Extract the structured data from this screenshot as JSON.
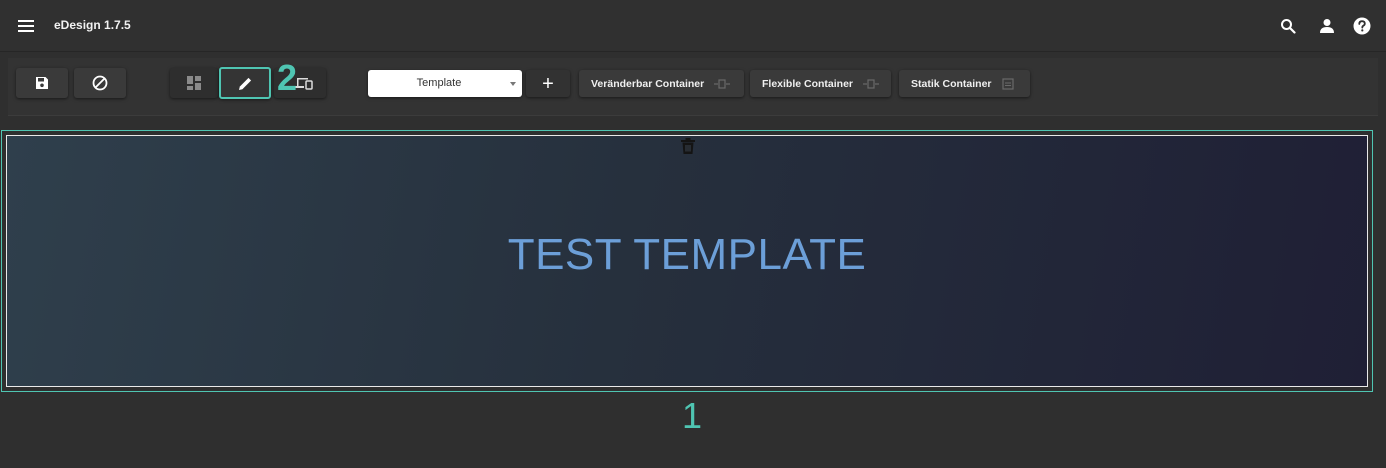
{
  "app": {
    "title": "eDesign 1.7.5",
    "icons": [
      "menu-icon",
      "search-icon",
      "account-icon",
      "help-icon"
    ]
  },
  "toolbar": {
    "save_icon": "floppy-disk-icon",
    "cancel_icon": "block-icon",
    "view_modes": [
      {
        "name": "grid-view",
        "icon": "dashboard-icon",
        "active": false
      },
      {
        "name": "edit-mode",
        "icon": "pencil-icon",
        "active": true
      },
      {
        "name": "device-preview",
        "icon": "devices-icon",
        "active": false
      }
    ],
    "template_select": {
      "value": "Template"
    },
    "add_label": "+",
    "containers": [
      {
        "label": "Veränderbar Container",
        "icon": "resize-icon"
      },
      {
        "label": "Flexible Container",
        "icon": "resize-icon"
      },
      {
        "label": "Statik Container",
        "icon": "static-box-icon"
      }
    ]
  },
  "annotations": {
    "badge_one": "1",
    "badge_two": "2"
  },
  "stage": {
    "title": "TEST TEMPLATE"
  },
  "colors": {
    "accent": "#4fc5b2",
    "title_blue": "#6c9fd8",
    "background": "#2f2f2f"
  }
}
